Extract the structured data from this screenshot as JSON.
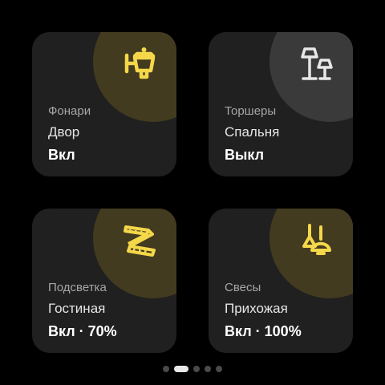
{
  "colors": {
    "accent": "#f5d84a",
    "tile_bg": "#202020",
    "on_circle": "#423b1f",
    "off_circle": "#3a3a3a",
    "off_icon": "#e8e8e8"
  },
  "tiles": [
    {
      "category": "Фонари",
      "room": "Двор",
      "state": "Вкл",
      "icon": "lantern-icon",
      "on": true
    },
    {
      "category": "Торшеры",
      "room": "Спальня",
      "state": "Выкл",
      "icon": "floor-lamp-icon",
      "on": false
    },
    {
      "category": "Подсветка",
      "room": "Гостиная",
      "state": "Вкл · 70%",
      "icon": "led-strip-icon",
      "on": true,
      "level_percent": 70
    },
    {
      "category": "Свесы",
      "room": "Прихожая",
      "state": "Вкл · 100%",
      "icon": "pendant-lamp-icon",
      "on": true,
      "level_percent": 100
    }
  ],
  "pager": {
    "page_count": 5,
    "active_page": 2
  }
}
